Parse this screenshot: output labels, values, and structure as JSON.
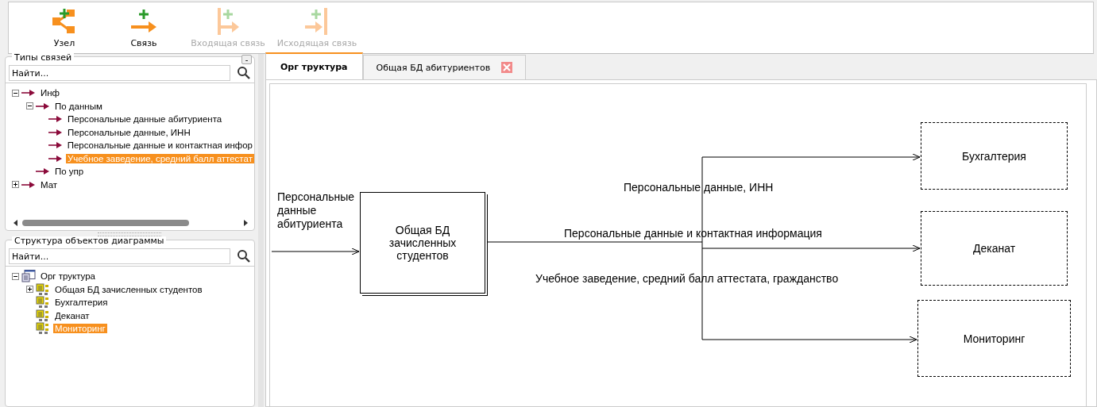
{
  "toolbar": [
    {
      "label": "Узел",
      "kind": "node",
      "disabled": false
    },
    {
      "label": "Связь",
      "kind": "link",
      "disabled": false
    },
    {
      "label": "Входящая связь",
      "kind": "incoming",
      "disabled": true
    },
    {
      "label": "Исходящая связь",
      "kind": "outgoing",
      "disabled": true
    }
  ],
  "relation_types": {
    "title": "Типы связей",
    "collapse_button": "-",
    "search": {
      "placeholder": "Найти..."
    },
    "tree": [
      {
        "label": "Инф",
        "expanded": true,
        "selected": false,
        "children": [
          {
            "label": "По данным",
            "expanded": true,
            "selected": false,
            "children": [
              {
                "label": "Персональные данные абитуриента",
                "selected": false
              },
              {
                "label": "Персональные данные, ИНН",
                "selected": false
              },
              {
                "label": "Персональные данные и контактная инфор",
                "selected": false
              },
              {
                "label": "Учебное заведение, средний балл аттестат",
                "selected": true
              }
            ]
          },
          {
            "label": "По упр",
            "selected": false
          }
        ]
      },
      {
        "label": "Мат",
        "expanded": false,
        "selected": false
      }
    ]
  },
  "diagram_objects": {
    "title": "Структура объектов диаграммы",
    "search": {
      "placeholder": "Найти..."
    },
    "tree": [
      {
        "label": "Орг труктура",
        "kind": "diagram",
        "expanded": true,
        "selected": false,
        "children": [
          {
            "label": "Общая БД зачисленных студентов",
            "kind": "object",
            "expanded": false,
            "selected": false
          },
          {
            "label": "Бухгалтерия",
            "kind": "object",
            "selected": false
          },
          {
            "label": "Деканат",
            "kind": "object",
            "selected": false
          },
          {
            "label": "Мониторинг",
            "kind": "object",
            "selected": true
          }
        ]
      }
    ]
  },
  "tabs": [
    {
      "label": "Орг труктура",
      "selected": true,
      "closable": false
    },
    {
      "label": "Общая БД абитуриентов",
      "selected": false,
      "closable": true
    }
  ],
  "diagram": {
    "input_label": "Персональные данные абитуриента",
    "nodes": [
      {
        "label": "Общая БД зачисленных студентов",
        "kind": "process"
      },
      {
        "label": "Бухгалтерия",
        "kind": "external"
      },
      {
        "label": "Деканат",
        "kind": "external"
      },
      {
        "label": "Мониторинг",
        "kind": "external"
      }
    ],
    "links": [
      {
        "label": "Персональные данные, ИНН"
      },
      {
        "label": "Персональные данные и контактная информация"
      },
      {
        "label": "Учебное заведение, средний балл аттестата, гражданство"
      }
    ]
  }
}
